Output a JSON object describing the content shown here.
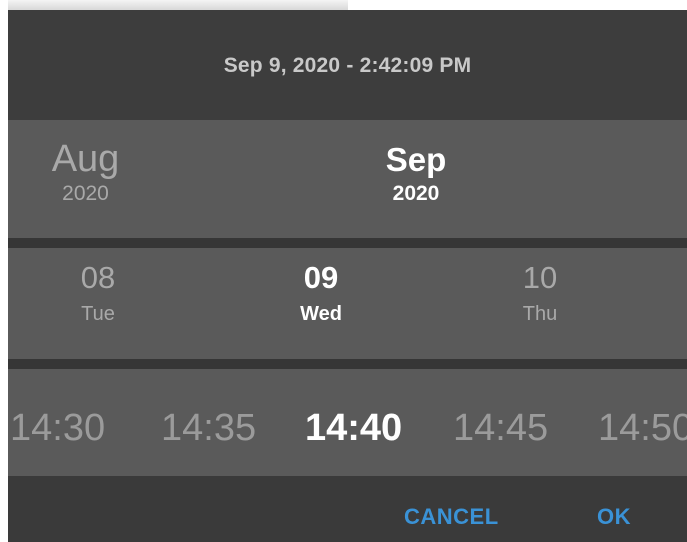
{
  "header": {
    "title": "Sep 9, 2020 - 2:42:09 PM"
  },
  "month_wheel": {
    "prev": {
      "month": "Aug",
      "year": "2020"
    },
    "selected": {
      "month": "Sep",
      "year": "2020"
    }
  },
  "day_wheel": {
    "prev": {
      "day": "08",
      "weekday": "Tue"
    },
    "selected": {
      "day": "09",
      "weekday": "Wed"
    },
    "next": {
      "day": "10",
      "weekday": "Thu"
    }
  },
  "time_wheel": {
    "items": [
      "14:30",
      "14:35",
      "14:40",
      "14:45",
      "14:50"
    ],
    "selected_index": 2
  },
  "footer": {
    "cancel_label": "CANCEL",
    "ok_label": "OK"
  },
  "colors": {
    "accent": "#3a92d6",
    "background": "#3b3b3b",
    "wheel": "#5a5a5a",
    "selected_text": "#ffffff",
    "unselected_text": "#a9a9a9"
  }
}
